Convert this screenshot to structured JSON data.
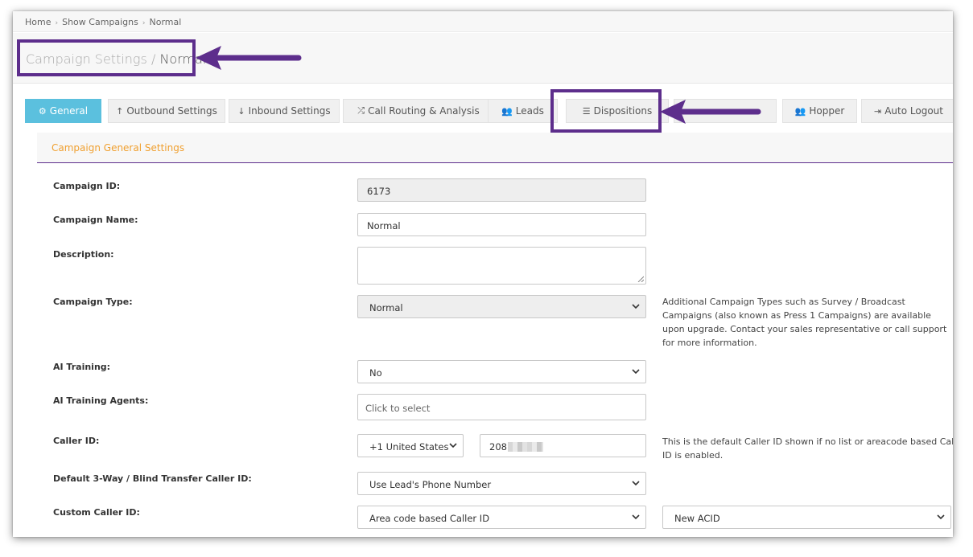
{
  "breadcrumb": [
    "Home",
    "Show Campaigns",
    "Normal"
  ],
  "title": {
    "section": "Campaign Settings",
    "separator": " / ",
    "current": "Normal"
  },
  "tabs": [
    {
      "label": "General",
      "icon": "cogs-icon",
      "active": true
    },
    {
      "label": "Outbound Settings",
      "icon": "arrow-up-icon",
      "active": false
    },
    {
      "label": "Inbound Settings",
      "icon": "arrow-down-icon",
      "active": false
    },
    {
      "label": "Call Routing & Analysis",
      "icon": "random-icon",
      "active": false
    },
    {
      "label": "Leads",
      "icon": "users-icon",
      "active": false
    },
    {
      "label": "Dispositions",
      "icon": "list-icon",
      "active": false
    },
    {
      "label": "Hopper",
      "icon": "users-icon",
      "active": false
    },
    {
      "label": "Auto Logout",
      "icon": "sign-out-icon",
      "active": false
    }
  ],
  "panel": {
    "title": "Campaign General Settings"
  },
  "form": {
    "campaign_id": {
      "label": "Campaign ID:",
      "value": "6173"
    },
    "campaign_name": {
      "label": "Campaign Name:",
      "value": "Normal"
    },
    "description": {
      "label": "Description:",
      "value": ""
    },
    "campaign_type": {
      "label": "Campaign Type:",
      "value": "Normal",
      "note": "Additional Campaign Types such as Survey / Broadcast Campaigns (also known as Press 1 Campaigns) are available upon upgrade. Contact your sales representative or call support for more information."
    },
    "ai_training": {
      "label": "AI Training:",
      "value": "No"
    },
    "ai_training_agents": {
      "label": "AI Training Agents:",
      "placeholder": "Click to select"
    },
    "caller_id": {
      "label": "Caller ID:",
      "country": "+1 United States",
      "number_prefix": "208",
      "note": "This is the default Caller ID shown if no list or areacode based Caller ID is enabled."
    },
    "transfer_caller_id": {
      "label": "Default 3-Way / Blind Transfer Caller ID:",
      "value": "Use Lead's Phone Number"
    },
    "custom_caller_id": {
      "label": "Custom Caller ID:",
      "value": "Area code based Caller ID",
      "secondary": "New ACID"
    }
  },
  "colors": {
    "accent_purple": "#5d2e8c",
    "active_tab": "#5bc0de",
    "panel_title": "#f0a030"
  }
}
